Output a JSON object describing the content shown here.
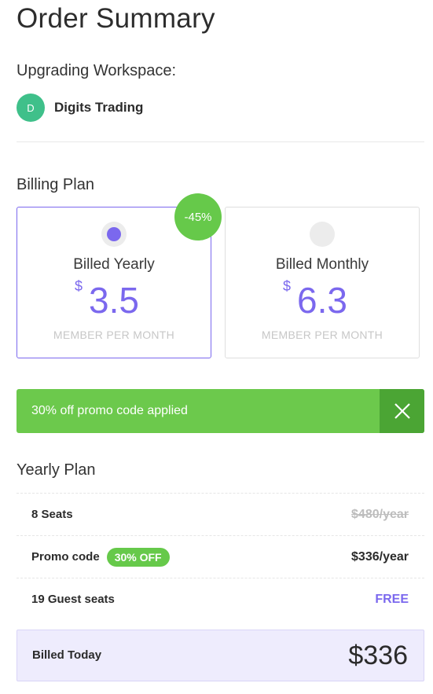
{
  "header": {
    "title": "Order Summary"
  },
  "workspace": {
    "label": "Upgrading Workspace:",
    "avatar_initial": "D",
    "avatar_color": "#3fc08a",
    "name": "Digits Trading"
  },
  "billing": {
    "section_label": "Billing Plan",
    "discount_badge": "-45%",
    "selected_plan": "yearly",
    "plans": [
      {
        "id": "yearly",
        "name": "Billed Yearly",
        "currency": "$",
        "amount": "3.5",
        "per_label": "MEMBER PER MONTH"
      },
      {
        "id": "monthly",
        "name": "Billed Monthly",
        "currency": "$",
        "amount": "6.3",
        "per_label": "MEMBER PER MONTH"
      }
    ]
  },
  "promo": {
    "text": "30% off promo code applied",
    "close_icon": "close-icon"
  },
  "summary": {
    "section_label": "Yearly Plan",
    "rows": [
      {
        "label": "8 Seats",
        "value": "$480/year"
      },
      {
        "label": "Promo code",
        "badge": "30% OFF",
        "value": "$336/year"
      },
      {
        "label": "19 Guest seats",
        "value": "FREE"
      }
    ],
    "total_label": "Billed Today",
    "total_value": "$336"
  },
  "colors": {
    "accent": "#7b68ee",
    "success": "#6cc94c",
    "success_dark": "#4ba534",
    "total_bg": "#eeecfd"
  }
}
